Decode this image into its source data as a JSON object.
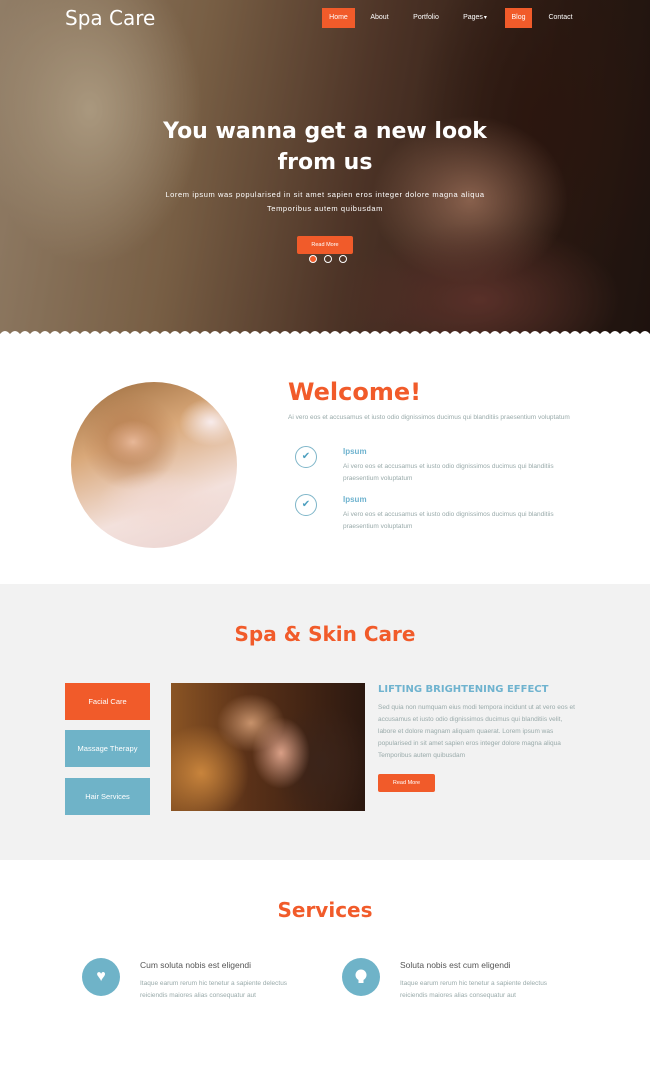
{
  "header": {
    "brand": "Spa Care",
    "nav": [
      {
        "label": "Home",
        "active": true
      },
      {
        "label": "About",
        "active": false
      },
      {
        "label": "Portfolio",
        "active": false
      },
      {
        "label": "Pages",
        "active": false,
        "dropdown": true
      },
      {
        "label": "Blog",
        "active": true
      },
      {
        "label": "Contact",
        "active": false
      }
    ]
  },
  "hero": {
    "title": "You wanna get a new look from us",
    "subtitle": "Lorem ipsum was popularised in sit amet sapien eros integer dolore magna aliqua Temporibus autem quibusdam",
    "button": "Read More",
    "slides": 3,
    "active_slide": 1
  },
  "welcome": {
    "title": "Welcome!",
    "desc": "Ai vero eos et accusamus et iusto odio dignissimos ducimus qui blanditiis praesentium voluptatum",
    "features": [
      {
        "icon": "check-icon",
        "title": "Ipsum",
        "desc": "Ai vero eos et accusamus et iusto odio dignissimos ducimus qui blanditiis praesentium voluptatum"
      },
      {
        "icon": "check-icon",
        "title": "Ipsum",
        "desc": "Ai vero eos et accusamus et iusto odio dignissimos ducimus qui blanditiis praesentium voluptatum"
      }
    ]
  },
  "skin": {
    "title": "Spa & Skin Care",
    "tabs": [
      {
        "label": "Facial Care",
        "active": true
      },
      {
        "label": "Massage Therapy",
        "active": false
      },
      {
        "label": "Hair Services",
        "active": false
      }
    ],
    "heading": "LIFTING BRIGHTENING EFFECT",
    "text": "Sed quia non numquam eius modi tempora incidunt ut at vero eos et accusamus et iusto odio dignissimos ducimus qui blanditiis velit, labore et dolore magnam aliquam quaerat. Lorem ipsum was popularised in sit amet sapien eros integer dolore magna aliqua Temporibus autem quibusdam",
    "button": "Read More"
  },
  "services": {
    "title": "Services",
    "items": [
      {
        "icon": "heart-icon",
        "title": "Cum soluta nobis est eligendi",
        "desc": "Itaque earum rerum hic tenetur a sapiente delectus reiciendis maiores alias consequatur aut"
      },
      {
        "icon": "lightbulb-icon",
        "title": "Soluta nobis est cum eligendi",
        "desc": "Itaque earum rerum hic tenetur a sapiente delectus reiciendis maiores alias consequatur aut"
      }
    ]
  },
  "colors": {
    "accent": "#f15b2a",
    "secondary": "#6fb3c8",
    "section_bg": "#f2f2f2"
  }
}
